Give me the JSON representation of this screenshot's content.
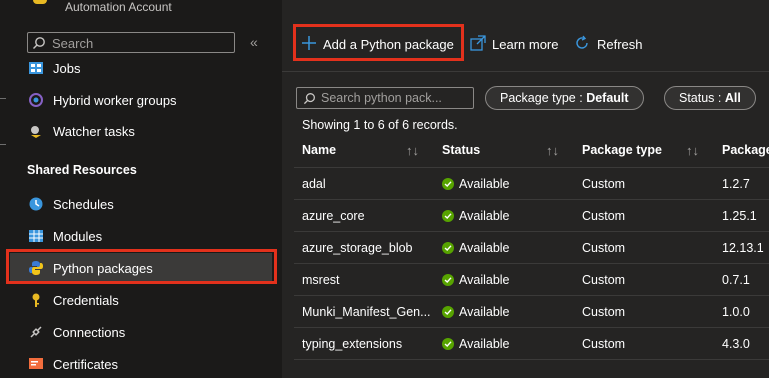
{
  "header": {
    "subtitle": "Automation Account"
  },
  "sidebar": {
    "search_placeholder": "Search",
    "collapse_glyph": "«",
    "items_top": [
      {
        "label": "Jobs",
        "icon": "jobs-icon"
      },
      {
        "label": "Hybrid worker groups",
        "icon": "hybrid-worker-icon"
      },
      {
        "label": "Watcher tasks",
        "icon": "watcher-icon"
      }
    ],
    "section_title": "Shared Resources",
    "items_shared": [
      {
        "label": "Schedules",
        "icon": "clock-icon"
      },
      {
        "label": "Modules",
        "icon": "modules-icon"
      },
      {
        "label": "Python packages",
        "icon": "python-icon",
        "selected": true
      },
      {
        "label": "Credentials",
        "icon": "key-icon"
      },
      {
        "label": "Connections",
        "icon": "plug-icon"
      },
      {
        "label": "Certificates",
        "icon": "certificate-icon"
      }
    ]
  },
  "toolbar": {
    "add_label": "Add a Python package",
    "learn_label": "Learn more",
    "refresh_label": "Refresh"
  },
  "filters": {
    "search_placeholder": "Search python pack...",
    "package_type_label": "Package type :",
    "package_type_value": "Default",
    "status_label": "Status :",
    "status_value": "All"
  },
  "records_text": "Showing 1 to 6 of 6 records.",
  "table": {
    "columns": [
      "Name",
      "Status",
      "Package type",
      "Package"
    ],
    "rows": [
      {
        "name": "adal",
        "status": "Available",
        "type": "Custom",
        "version": "1.2.7"
      },
      {
        "name": "azure_core",
        "status": "Available",
        "type": "Custom",
        "version": "1.25.1"
      },
      {
        "name": "azure_storage_blob",
        "status": "Available",
        "type": "Custom",
        "version": "12.13.1"
      },
      {
        "name": "msrest",
        "status": "Available",
        "type": "Custom",
        "version": "0.7.1"
      },
      {
        "name": "Munki_Manifest_Gen...",
        "status": "Available",
        "type": "Custom",
        "version": "1.0.0"
      },
      {
        "name": "typing_extensions",
        "status": "Available",
        "type": "Custom",
        "version": "4.3.0"
      }
    ]
  },
  "colors": {
    "accent": "#3a96dd",
    "highlight_border": "#e3311c",
    "success": "#57a300"
  }
}
